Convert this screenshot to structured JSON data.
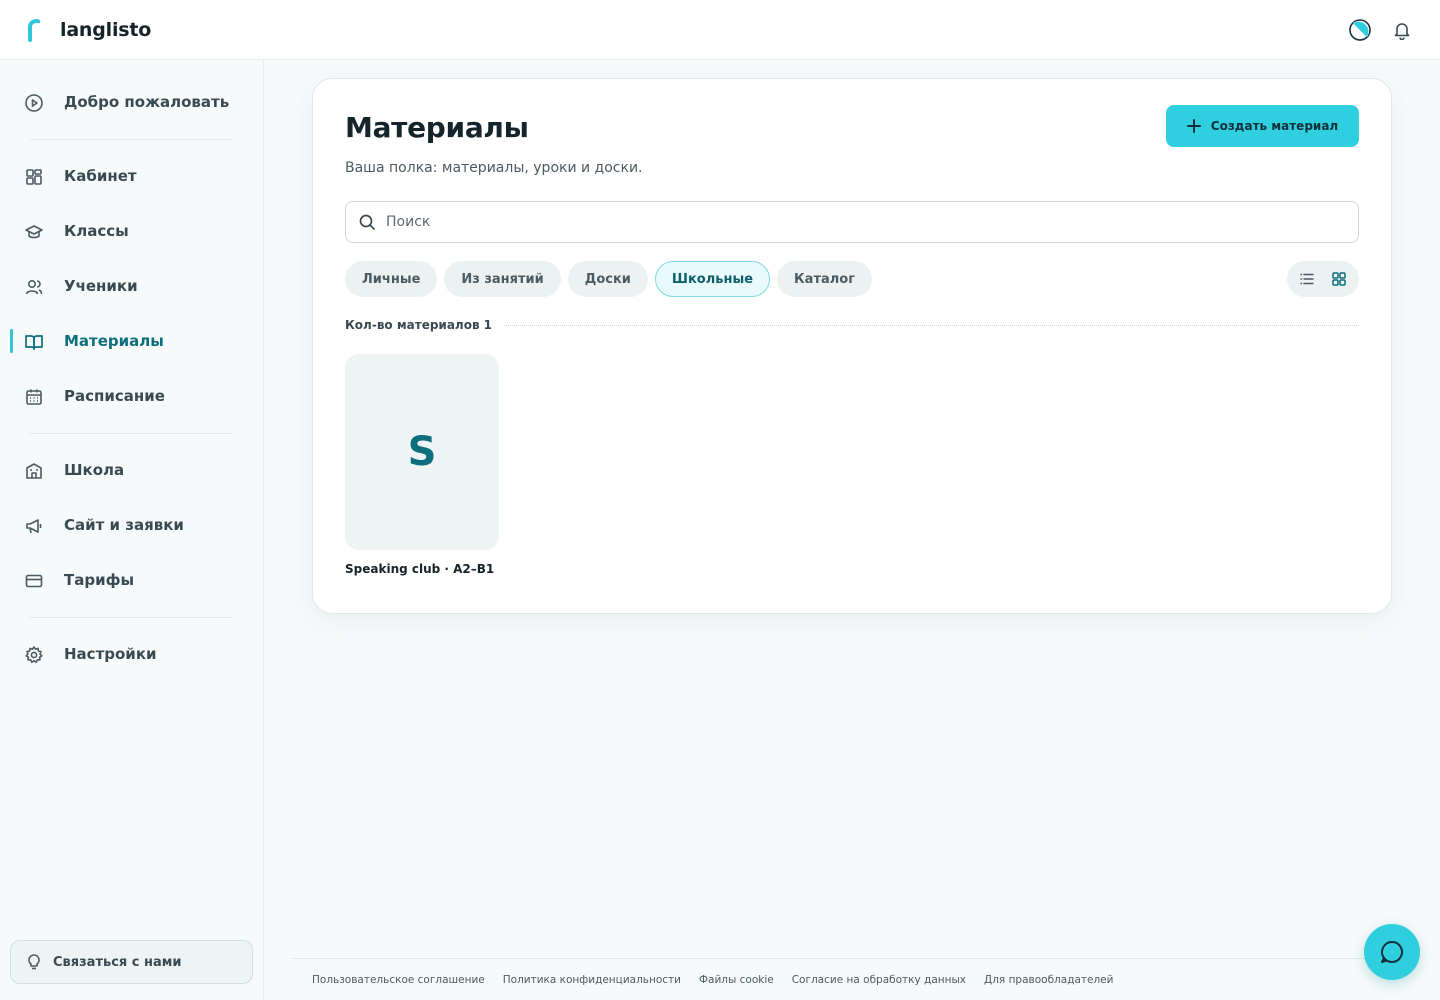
{
  "app": {
    "name": "langlisto"
  },
  "colors": {
    "accent": "#30cfe0",
    "active_text": "#0d6e7d",
    "primary_text": "#15232a"
  },
  "sidebar": {
    "items": [
      {
        "label": "Добро пожаловать",
        "icon": "play-circle-icon"
      },
      {
        "label": "Кабинет",
        "icon": "dashboard-icon"
      },
      {
        "label": "Классы",
        "icon": "graduation-cap-icon"
      },
      {
        "label": "Ученики",
        "icon": "users-icon"
      },
      {
        "label": "Материалы",
        "icon": "book-open-icon",
        "active": true
      },
      {
        "label": "Расписание",
        "icon": "calendar-icon"
      },
      {
        "label": "Школа",
        "icon": "school-building-icon"
      },
      {
        "label": "Сайт и заявки",
        "icon": "megaphone-icon"
      },
      {
        "label": "Тарифы",
        "icon": "credit-card-icon"
      },
      {
        "label": "Настройки",
        "icon": "gear-icon"
      }
    ],
    "contact_label": "Связаться с нами"
  },
  "main": {
    "title": "Материалы",
    "subtitle": "Ваша полка: материалы, уроки и доски.",
    "create_label": "Создать материал",
    "search_placeholder": "Поиск",
    "filters": [
      {
        "label": "Личные"
      },
      {
        "label": "Из занятий"
      },
      {
        "label": "Доски"
      },
      {
        "label": "Школьные",
        "active": true
      },
      {
        "label": "Каталог"
      }
    ],
    "count_label": "Кол-во материалов",
    "count": "1",
    "materials": [
      {
        "letter": "S",
        "title": "Speaking club · A2–B1"
      }
    ]
  },
  "footer": {
    "links": [
      "Пользовательское соглашение",
      "Политика конфиденциальности",
      "Файлы cookie",
      "Согласие на обработку данных",
      "Для правообладателей"
    ]
  }
}
